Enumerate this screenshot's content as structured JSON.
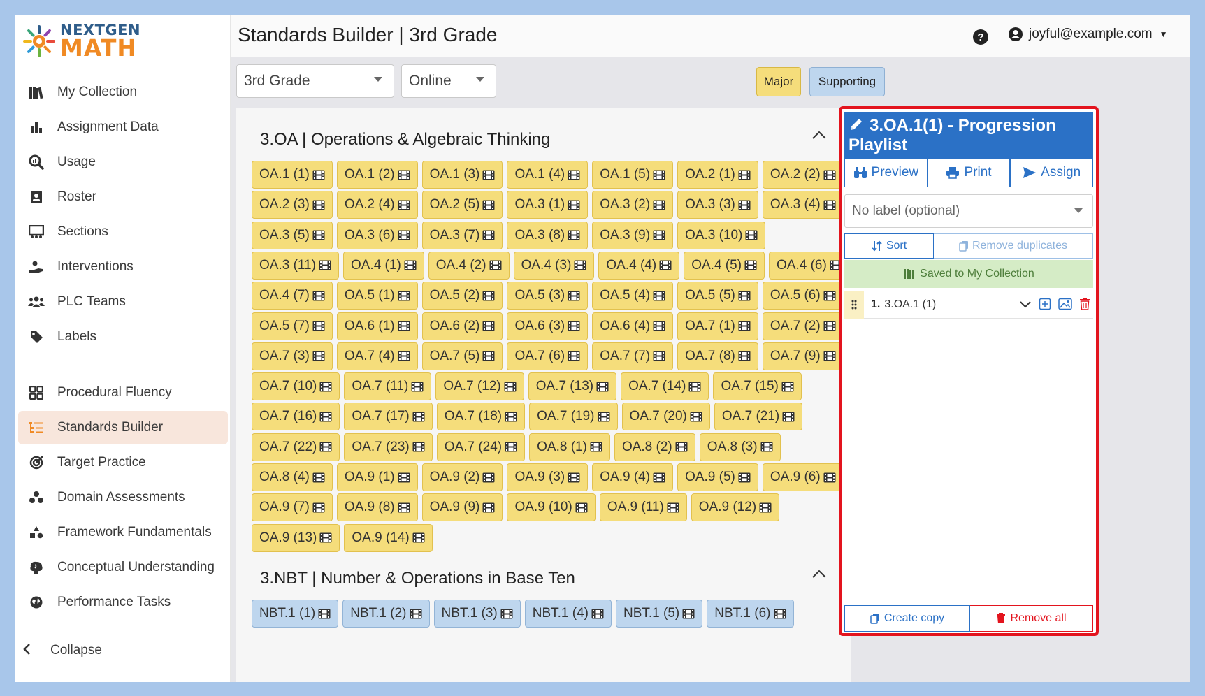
{
  "app": {
    "logo_top": "NEXTGEN",
    "logo_bottom": "MATH"
  },
  "colors": {
    "accent": "#2b71c6",
    "major": "#f5dd7b",
    "supporting": "#bed6ee",
    "highlight_border": "#e3141e",
    "active_nav": "#f8e6dc"
  },
  "sidebar": {
    "items": [
      {
        "label": "My Collection",
        "icon": "books-icon"
      },
      {
        "label": "Assignment Data",
        "icon": "bar-chart-icon"
      },
      {
        "label": "Usage",
        "icon": "search-chart-icon"
      },
      {
        "label": "Roster",
        "icon": "id-card-icon"
      },
      {
        "label": "Sections",
        "icon": "sections-icon"
      },
      {
        "label": "Interventions",
        "icon": "hand-icon"
      },
      {
        "label": "PLC Teams",
        "icon": "users-icon"
      },
      {
        "label": "Labels",
        "icon": "tag-icon"
      }
    ],
    "items2": [
      {
        "label": "Procedural Fluency",
        "icon": "grid-icon"
      },
      {
        "label": "Standards Builder",
        "icon": "list-tree-icon",
        "active": true
      },
      {
        "label": "Target Practice",
        "icon": "target-icon"
      },
      {
        "label": "Domain Assessments",
        "icon": "shapes-icon"
      },
      {
        "label": "Framework Fundamentals",
        "icon": "blocks-icon"
      },
      {
        "label": "Conceptual Understanding",
        "icon": "brain-icon"
      },
      {
        "label": "Performance Tasks",
        "icon": "globe-icon"
      }
    ],
    "collapse_label": "Collapse"
  },
  "header": {
    "title": "Standards Builder | 3rd Grade",
    "user_email": "joyful@example.com"
  },
  "filters": {
    "grade": "3rd Grade",
    "mode": "Online",
    "major_label": "Major",
    "supporting_label": "Supporting"
  },
  "domains": {
    "oa": {
      "title": "3.OA | Operations & Algebraic Thinking",
      "rows": [
        [
          "OA.1 (1)",
          "OA.1 (2)",
          "OA.1 (3)",
          "OA.1 (4)",
          "OA.1 (5)",
          "OA.2 (1)",
          "OA.2 (2)"
        ],
        [
          "OA.2 (3)",
          "OA.2 (4)",
          "OA.2 (5)",
          "OA.3 (1)",
          "OA.3 (2)",
          "OA.3 (3)",
          "OA.3 (4)"
        ],
        [
          "OA.3 (5)",
          "OA.3 (6)",
          "OA.3 (7)",
          "OA.3 (8)",
          "OA.3 (9)",
          "OA.3 (10)"
        ],
        [
          "OA.3 (11)",
          "OA.4 (1)",
          "OA.4 (2)",
          "OA.4 (3)",
          "OA.4 (4)",
          "OA.4 (5)",
          "OA.4 (6)"
        ],
        [
          "OA.4 (7)",
          "OA.5 (1)",
          "OA.5 (2)",
          "OA.5 (3)",
          "OA.5 (4)",
          "OA.5 (5)",
          "OA.5 (6)"
        ],
        [
          "OA.5 (7)",
          "OA.6 (1)",
          "OA.6 (2)",
          "OA.6 (3)",
          "OA.6 (4)",
          "OA.7 (1)",
          "OA.7 (2)"
        ],
        [
          "OA.7 (3)",
          "OA.7 (4)",
          "OA.7 (5)",
          "OA.7 (6)",
          "OA.7 (7)",
          "OA.7 (8)",
          "OA.7 (9)"
        ],
        [
          "OA.7 (10)",
          "OA.7 (11)",
          "OA.7 (12)",
          "OA.7 (13)",
          "OA.7 (14)",
          "OA.7 (15)"
        ],
        [
          "OA.7 (16)",
          "OA.7 (17)",
          "OA.7 (18)",
          "OA.7 (19)",
          "OA.7 (20)",
          "OA.7 (21)"
        ],
        [
          "OA.7 (22)",
          "OA.7 (23)",
          "OA.7 (24)",
          "OA.8 (1)",
          "OA.8 (2)",
          "OA.8 (3)"
        ],
        [
          "OA.8 (4)",
          "OA.9 (1)",
          "OA.9 (2)",
          "OA.9 (3)",
          "OA.9 (4)",
          "OA.9 (5)",
          "OA.9 (6)"
        ],
        [
          "OA.9 (7)",
          "OA.9 (8)",
          "OA.9 (9)",
          "OA.9 (10)",
          "OA.9 (11)",
          "OA.9 (12)"
        ],
        [
          "OA.9 (13)",
          "OA.9 (14)"
        ]
      ]
    },
    "nbt": {
      "title": "3.NBT | Number & Operations in Base Ten",
      "rows": [
        [
          "NBT.1 (1)",
          "NBT.1 (2)",
          "NBT.1 (3)",
          "NBT.1 (4)",
          "NBT.1 (5)",
          "NBT.1 (6)"
        ]
      ]
    }
  },
  "playlist": {
    "title": "3.OA.1(1) - Progression Playlist",
    "preview_label": "Preview",
    "print_label": "Print",
    "assign_label": "Assign",
    "label_placeholder": "No label (optional)",
    "sort_label": "Sort",
    "remove_duplicates_label": "Remove duplicates",
    "saved_label": "Saved to My Collection",
    "items": [
      {
        "number": "1.",
        "label": "3.OA.1 (1)"
      }
    ],
    "create_copy_label": "Create copy",
    "remove_all_label": "Remove all"
  }
}
